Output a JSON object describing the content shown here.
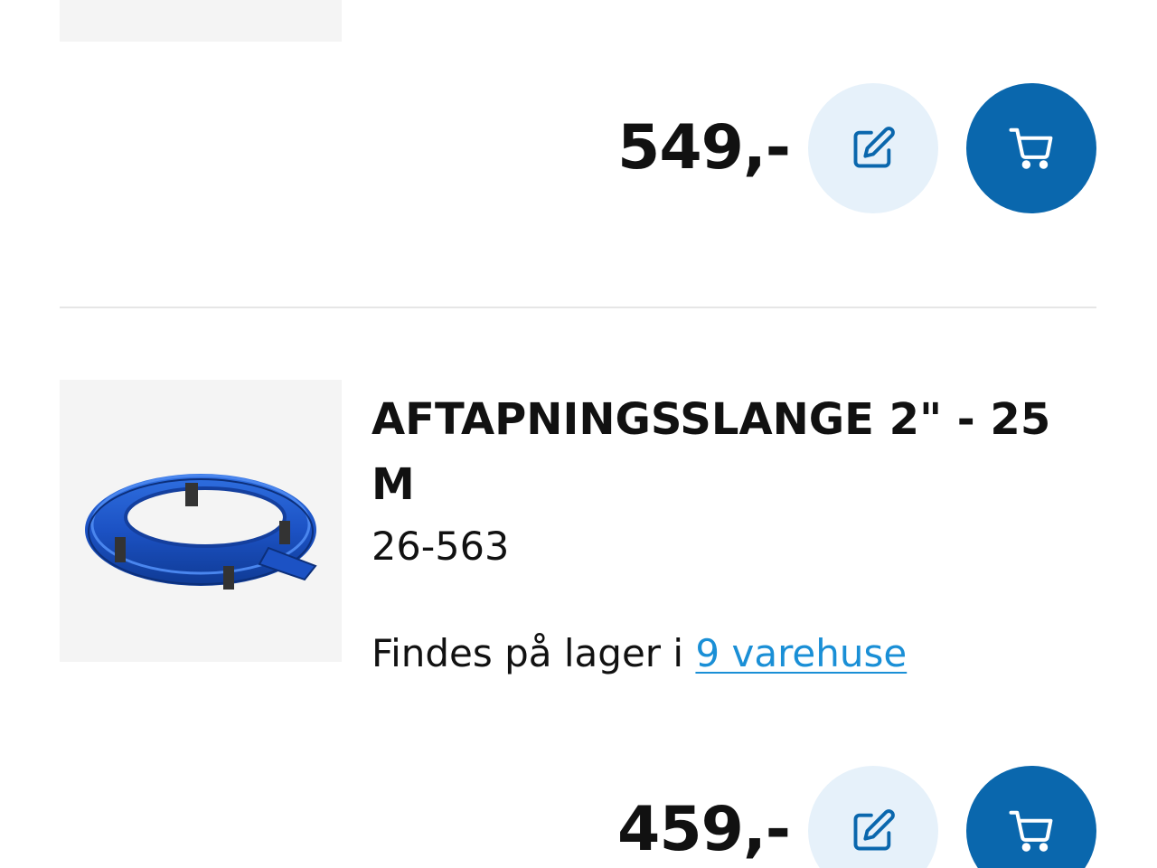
{
  "items": [
    {
      "price": "549,-",
      "edit_icon": "edit-icon",
      "cart_icon": "cart-icon"
    },
    {
      "title": "AFTAPNINGSSLANGE 2\" - 25 M",
      "sku": "26-563",
      "stock_prefix": "Findes på lager i ",
      "stock_link": "9 varehuse",
      "price": "459,-",
      "image": "blue-lay-flat-hose",
      "edit_icon": "edit-icon",
      "cart_icon": "cart-icon"
    }
  ],
  "colors": {
    "accent": "#0a67ad",
    "edit_bg": "#e6f1fa",
    "link": "#1a8fd6",
    "thumb_bg": "#f4f4f4"
  }
}
